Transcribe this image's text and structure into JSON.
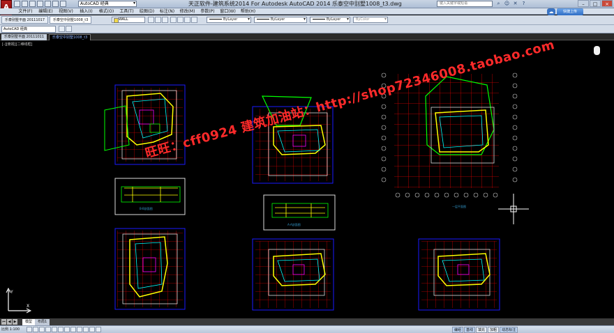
{
  "window": {
    "title": "天正软件-建筑系统2014  For Autodesk AutoCAD 2014    乐泰空中别墅1008_t3.dwg",
    "workspace": "AutoCAD 经典",
    "help_search_placeholder": "键入关键字或短语",
    "login_label": "快捷上传"
  },
  "menus": [
    "文件(F)",
    "编辑(E)",
    "视图(V)",
    "插入(I)",
    "格式(O)",
    "工具(T)",
    "绘图(D)",
    "标注(N)",
    "修改(M)",
    "参数(P)",
    "窗口(W)",
    "帮助(H)"
  ],
  "toolbar": {
    "mini_tabs": [
      "乐泰别墅平面 20111017",
      "乐泰空中别墅1008_t3"
    ],
    "layer_name": "WALL",
    "color_value": "ByLayer",
    "linetype_value": "ByLayer",
    "lineweight_value": "ByLayer",
    "plotstyle_value": "ByColor",
    "workspace_secondary": "AutoCAD 经典"
  },
  "document_tabs": [
    "乐泰别墅平面 20111011",
    "乐泰空中别墅1008_t3"
  ],
  "drawing": {
    "view_label": "[-][俯视][二维线框]",
    "plan_labels": [
      "B-B剖面图",
      "A-A剖面图",
      "一层平面图"
    ],
    "watermark": "旺旺：cff0924  建筑加油站：http://shop72346008.taobao.com"
  },
  "layout_tabs": [
    "模型",
    "布局1"
  ],
  "status": {
    "scale": "比例 1:100",
    "toggles": [
      "编组",
      "基线",
      "填充",
      "加粗",
      "动态标注"
    ]
  },
  "colors": {
    "background": "#000000",
    "frame": "#0000ff",
    "grid": "#ff0000",
    "walls": "#ffff00",
    "outline": "#00ff00",
    "watermark": "#ff2a2a"
  }
}
